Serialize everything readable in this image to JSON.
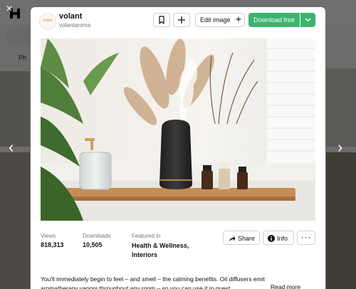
{
  "background": {
    "tabs_label": "Ph"
  },
  "modal": {
    "author": {
      "name": "volant",
      "handle": "volantaroma",
      "avatar_text": "volant"
    },
    "toolbar": {
      "bookmark_icon": "bookmark-icon",
      "add_icon": "plus-icon",
      "edit_label": "Edit image",
      "download_label": "Download free",
      "download_menu_icon": "chevron-down-icon"
    },
    "photo": {
      "subject": "aroma-diffuser-with-essential-oils"
    },
    "stats": {
      "views_label": "Views",
      "views_value": "818,313",
      "downloads_label": "Downloads",
      "downloads_value": "10,505",
      "featured_label": "Featured in",
      "featured_value": "Health & Wellness, Interiors"
    },
    "actions": {
      "share_label": "Share",
      "info_label": "Info",
      "more_label": "···"
    },
    "description": "You'll immediately begin to feel – and smell – the calming benefits. Oil diffusers emit aromatherapy vapors throughout any room – so you can use it in guest",
    "read_more": "Read more"
  },
  "controls": {
    "close": "×",
    "prev": "‹",
    "next": "›"
  },
  "colors": {
    "accent": "#3cb46e",
    "overlay": "rgba(0,0,0,0.55)"
  }
}
